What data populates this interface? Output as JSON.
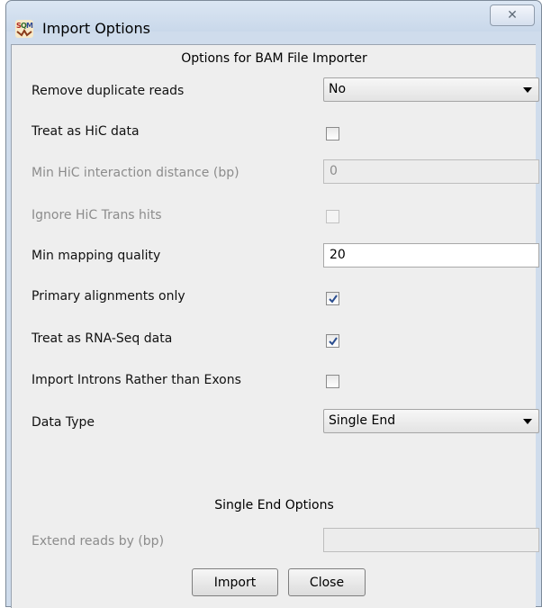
{
  "window": {
    "title": "Import Options",
    "icon": "seqmonk-app-icon",
    "close_glyph": "✕"
  },
  "dialog": {
    "header": "Options for BAM File Importer",
    "rows": {
      "remove_duplicates": {
        "label": "Remove duplicate reads",
        "value": "No"
      },
      "treat_hic": {
        "label": "Treat as HiC data",
        "checked": false
      },
      "min_hic_distance": {
        "label": "Min HiC interaction distance (bp)",
        "value": "0",
        "disabled": true
      },
      "ignore_hic_trans": {
        "label": "Ignore HiC Trans hits",
        "checked": false,
        "disabled": true
      },
      "min_mapping_quality": {
        "label": "Min mapping quality",
        "value": "20"
      },
      "primary_only": {
        "label": "Primary alignments only",
        "checked": true
      },
      "treat_rnaseq": {
        "label": "Treat as RNA-Seq data",
        "checked": true
      },
      "import_introns": {
        "label": "Import Introns Rather than Exons",
        "checked": false
      },
      "data_type": {
        "label": "Data Type",
        "value": "Single End"
      }
    },
    "single_end_header": "Single End Options",
    "extend_reads": {
      "label": "Extend reads by (bp)",
      "value": "",
      "disabled": true
    },
    "buttons": {
      "import": "Import",
      "close": "Close"
    }
  },
  "colors": {
    "frame": "#cfdcec",
    "client_bg": "#eeeeee",
    "disabled_text": "#8c8c8c",
    "check_mark": "#2a4d8f"
  }
}
